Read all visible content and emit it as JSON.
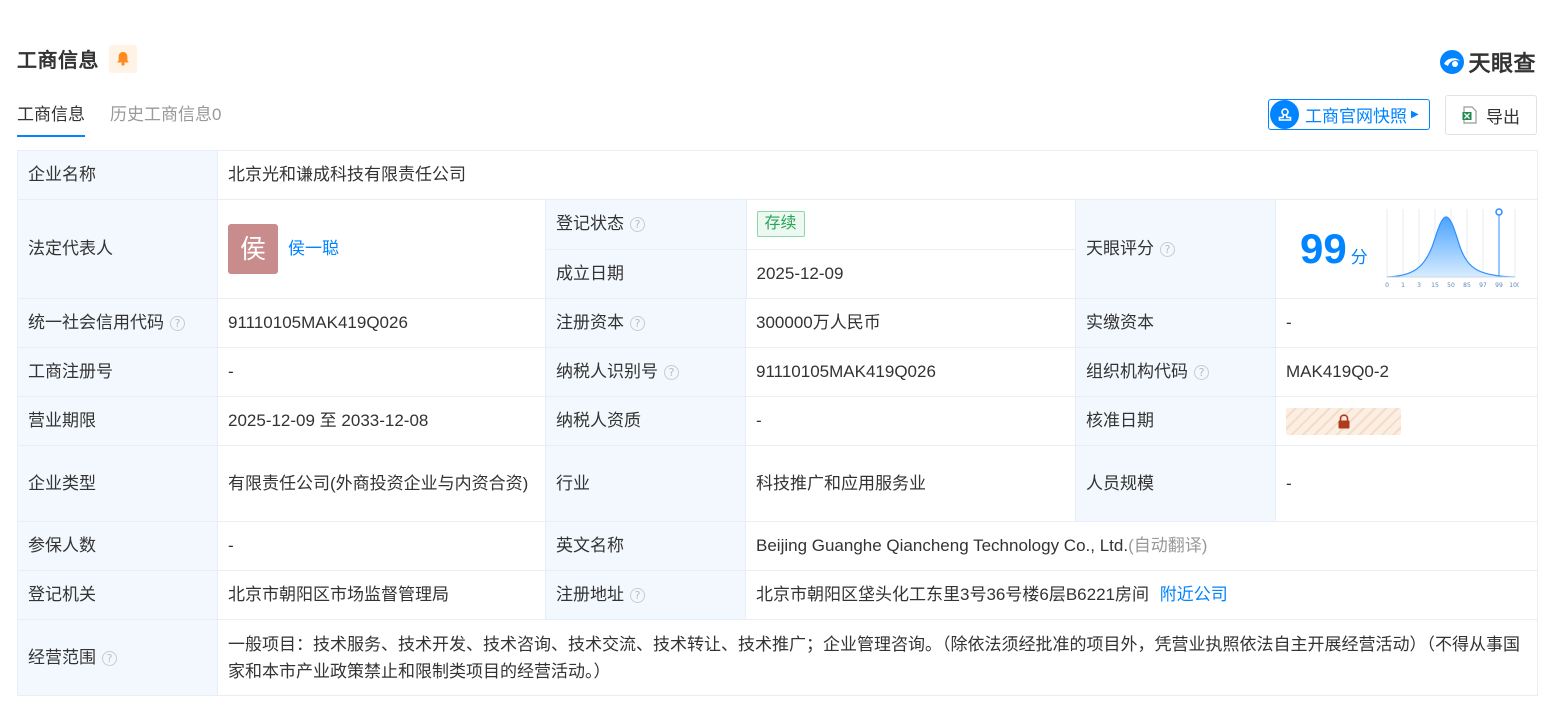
{
  "header": {
    "title": "工商信息",
    "logo_text": "天眼查"
  },
  "tabs": [
    {
      "label": "工商信息"
    },
    {
      "label": "历史工商信息0"
    }
  ],
  "toolbar": {
    "snapshot_label": "工商官网快照",
    "export_label": "导出"
  },
  "info": {
    "company_name": {
      "label": "企业名称",
      "value": "北京光和谦成科技有限责任公司"
    },
    "legal_rep": {
      "label": "法定代表人",
      "avatar_char": "侯",
      "name": "侯一聪"
    },
    "reg_status": {
      "label": "登记状态",
      "value": "存续"
    },
    "established": {
      "label": "成立日期",
      "value": "2025-12-09"
    },
    "score": {
      "label": "天眼评分",
      "value": "99",
      "unit": "分"
    },
    "credit_code": {
      "label": "统一社会信用代码",
      "value": "91110105MAK419Q026"
    },
    "reg_capital": {
      "label": "注册资本",
      "value": "300000万人民币"
    },
    "paid_capital": {
      "label": "实缴资本",
      "value": "-"
    },
    "reg_number": {
      "label": "工商注册号",
      "value": "-"
    },
    "taxpayer_id": {
      "label": "纳税人识别号",
      "value": "91110105MAK419Q026"
    },
    "org_code": {
      "label": "组织机构代码",
      "value": "MAK419Q0-2"
    },
    "term": {
      "label": "营业期限",
      "value": "2025-12-09 至 2033-12-08"
    },
    "taxpayer_qual": {
      "label": "纳税人资质",
      "value": "-"
    },
    "approval_date": {
      "label": "核准日期"
    },
    "company_type": {
      "label": "企业类型",
      "value": "有限责任公司(外商投资企业与内资合资)"
    },
    "industry": {
      "label": "行业",
      "value": "科技推广和应用服务业"
    },
    "staff_size": {
      "label": "人员规模",
      "value": "-"
    },
    "insured": {
      "label": "参保人数",
      "value": "-"
    },
    "english_name": {
      "label": "英文名称",
      "value": "Beijing Guanghe Qiancheng Technology Co., Ltd.",
      "translate_note": "(自动翻译)"
    },
    "authority": {
      "label": "登记机关",
      "value": "北京市朝阳区市场监督管理局"
    },
    "address": {
      "label": "注册地址",
      "value": "北京市朝阳区垡头化工东里3号36号楼6层B6221房间",
      "nearby_link": "附近公司"
    },
    "scope": {
      "label": "经营范围",
      "value": "一般项目：技术服务、技术开发、技术咨询、技术交流、技术转让、技术推广；企业管理咨询。（除依法须经批准的项目外，凭营业执照依法自主开展经营活动）（不得从事国家和本市产业政策禁止和限制类项目的经营活动。）"
    }
  },
  "score_chart": {
    "ticks": [
      "0",
      "1",
      "3",
      "15",
      "50",
      "85",
      "97",
      "99",
      "100"
    ]
  },
  "colors": {
    "accent": "#0084ff",
    "label_bg": "#f3f8fe",
    "status_green": "#29a35a",
    "avatar_bg": "#c98c8c"
  }
}
